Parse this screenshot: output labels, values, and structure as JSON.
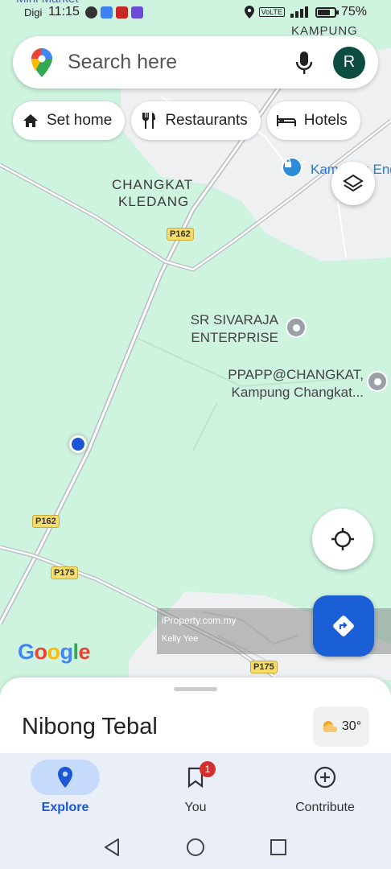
{
  "status_bar": {
    "carrier": "Digi",
    "time": "11:15",
    "battery": "75%",
    "battery_level": 0.75
  },
  "map": {
    "places": {
      "changkat": "CHANGKAT",
      "kledang": "KLEDANG",
      "kampung": "KAMPUNG",
      "kampung_poi": "Kampung Engin"
    },
    "pois": {
      "sivaraja_line1": "SR SIVARAJA",
      "sivaraja_line2": "ENTERPRISE",
      "ppapp_line1": "PPAPP@CHANGKAT,",
      "ppapp_line2": "Kampung Changkat..."
    },
    "roads": {
      "p162_top": "P162",
      "p162_bottom": "P162",
      "p175_left": "P175",
      "p175_bottom": "P175"
    },
    "partial_top_label": "Mini Market",
    "google_logo": "Google",
    "watermark_brand": "iProperty.com.my",
    "watermark_user": "Kelly Yee"
  },
  "search": {
    "placeholder": "Search here",
    "avatar_initial": "R"
  },
  "chips": {
    "set_home": "Set home",
    "restaurants": "Restaurants",
    "hotels": "Hotels"
  },
  "sheet": {
    "place_name": "Nibong Tebal",
    "temperature": "30°"
  },
  "nav": {
    "explore": "Explore",
    "you": "You",
    "you_badge": "1",
    "contribute": "Contribute",
    "active": "Explore"
  },
  "colors": {
    "map_green": "#cef3df",
    "accent_blue": "#1a56d6",
    "avatar_green": "#0d4d3f",
    "road_shield_yellow": "#f6dc6a"
  }
}
